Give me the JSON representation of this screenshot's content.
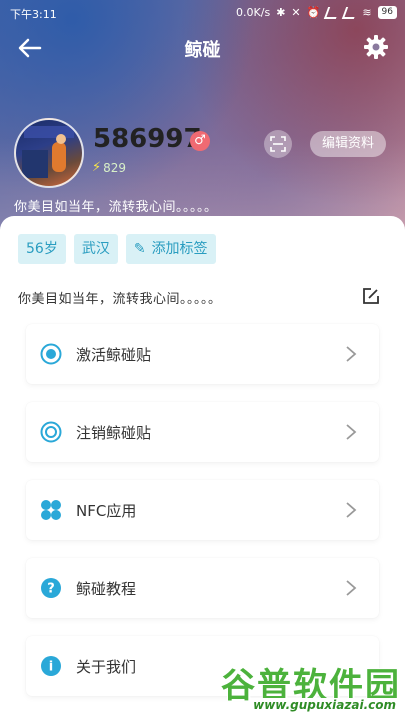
{
  "statusbar": {
    "time": "下午3:11",
    "network_speed": "0.0K/s",
    "battery": "96"
  },
  "nav": {
    "title": "鲸碰"
  },
  "profile": {
    "username": "586997",
    "gender_symbol": "♂",
    "energy": "829",
    "edit_profile_label": "编辑资料",
    "bio": "你美目如当年，流转我心间。。。。。"
  },
  "tags": [
    {
      "label": "56岁"
    },
    {
      "label": "武汉"
    },
    {
      "label": "添加标签"
    }
  ],
  "bio_panel": "你美目如当年，流转我心间。。。。。",
  "menu": [
    {
      "label": "激活鲸碰贴",
      "icon": "radio-filled-icon"
    },
    {
      "label": "注销鲸碰贴",
      "icon": "radio-ring-icon"
    },
    {
      "label": "NFC应用",
      "icon": "grid-petals-icon"
    },
    {
      "label": "鲸碰教程",
      "icon": "question-icon"
    },
    {
      "label": "关于我们",
      "icon": "info-icon"
    }
  ],
  "watermark": {
    "main": "谷普软件园",
    "url": "www.gupuxiazai.com"
  },
  "colors": {
    "accent": "#2a9dc0",
    "tag_bg": "#d9f1f6",
    "gender": "#f06a72",
    "watermark": "#4cb23c"
  }
}
